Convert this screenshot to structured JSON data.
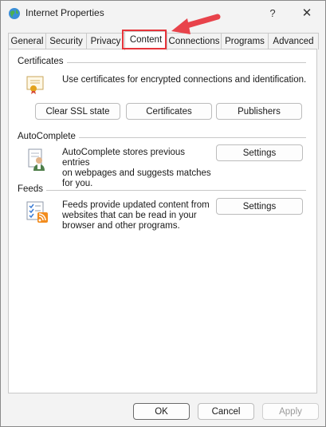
{
  "window": {
    "title": "Internet Properties",
    "help": "?",
    "close": "✕"
  },
  "tabs": [
    {
      "label": "General"
    },
    {
      "label": "Security"
    },
    {
      "label": "Privacy"
    },
    {
      "label": "Content",
      "active": true
    },
    {
      "label": "Connections"
    },
    {
      "label": "Programs"
    },
    {
      "label": "Advanced"
    }
  ],
  "certificates": {
    "title": "Certificates",
    "description": "Use certificates for encrypted connections and identification.",
    "buttons": {
      "clear_ssl": "Clear SSL state",
      "certificates": "Certificates",
      "publishers": "Publishers"
    },
    "icon": "certificate-icon"
  },
  "autocomplete": {
    "title": "AutoComplete",
    "description": [
      "AutoComplete stores previous entries",
      "on webpages and suggests matches",
      "for you."
    ],
    "settings": "Settings",
    "icon": "autocomplete-user-icon"
  },
  "feeds": {
    "title": "Feeds",
    "description": [
      "Feeds provide updated content from",
      "websites that can be read in your",
      "browser and other programs."
    ],
    "settings": "Settings",
    "icon": "feeds-rss-icon"
  },
  "footer": {
    "ok": "OK",
    "cancel": "Cancel",
    "apply": "Apply"
  },
  "colors": {
    "highlight": "#e6353b",
    "arrow": "#e8434b"
  }
}
